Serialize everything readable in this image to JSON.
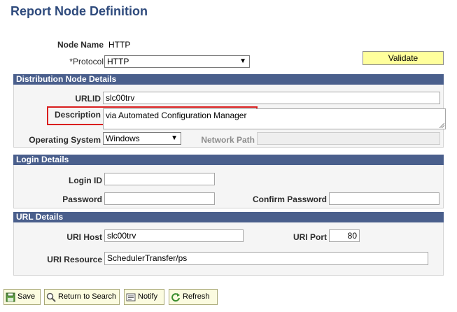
{
  "page": {
    "title": "Report Node Definition"
  },
  "header": {
    "node_name_label": "Node Name",
    "node_name_value": "HTTP",
    "protocol_label": "*Protocol",
    "protocol_value": "HTTP",
    "validate_label": "Validate"
  },
  "distribution": {
    "title": "Distribution Node Details",
    "urlid_label": "URLID",
    "urlid_value": "slc00trv",
    "description_label": "Description",
    "description_value": "via Automated Configuration Manager",
    "os_label": "Operating System",
    "os_value": "Windows",
    "network_path_label": "Network Path",
    "network_path_value": ""
  },
  "login": {
    "title": "Login Details",
    "login_id_label": "Login ID",
    "login_id_value": "",
    "password_label": "Password",
    "password_value": "",
    "confirm_password_label": "Confirm Password",
    "confirm_password_value": ""
  },
  "url": {
    "title": "URL Details",
    "uri_host_label": "URI Host",
    "uri_host_value": "slc00trv",
    "uri_port_label": "URI Port",
    "uri_port_value": "80",
    "uri_resource_label": "URI Resource",
    "uri_resource_value": "SchedulerTransfer/ps"
  },
  "toolbar": {
    "save_label": "Save",
    "return_label": "Return to Search",
    "notify_label": "Notify",
    "refresh_label": "Refresh"
  },
  "colors": {
    "title": "#2e4a7c",
    "section_header": "#4a5f8c",
    "validate_bg": "#ffff9c",
    "highlight": "#d91e1e"
  }
}
